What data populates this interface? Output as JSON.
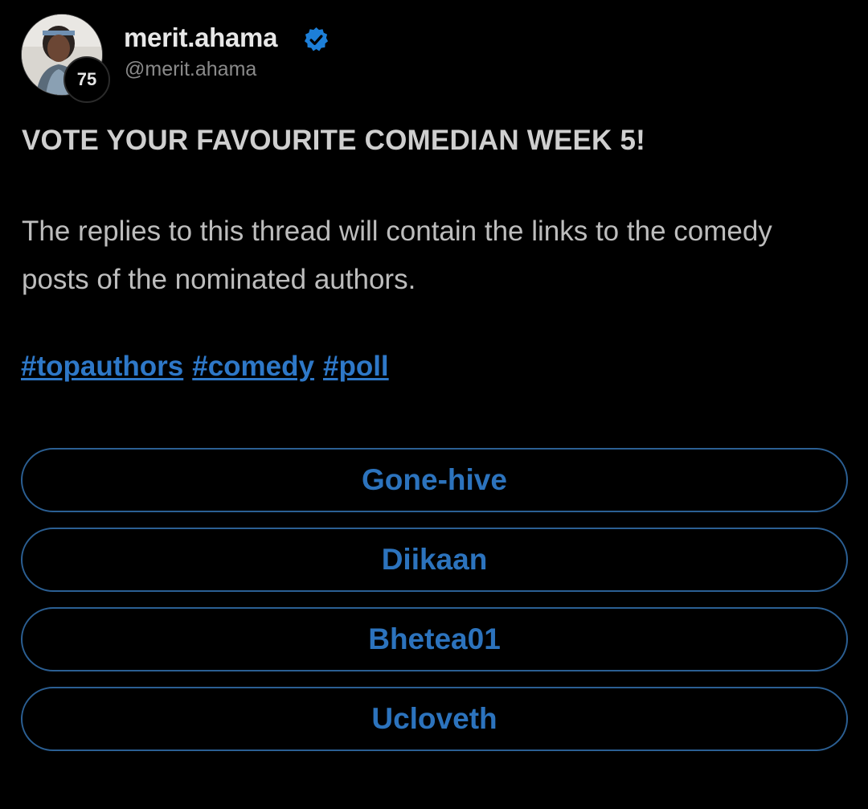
{
  "post": {
    "author": {
      "name": "merit.ahama",
      "handle": "@merit.ahama",
      "reputation": "75",
      "verified": true
    },
    "title": "VOTE YOUR FAVOURITE COMEDIAN WEEK 5!",
    "body": "The replies to this thread will contain the links to the comedy posts of the nominated authors.",
    "tags": [
      "#topauthors",
      "#comedy",
      "#poll"
    ]
  },
  "poll": {
    "options": [
      "Gone-hive",
      "Diikaan",
      "Bhetea01",
      "Ucloveth"
    ]
  },
  "colors": {
    "background": "#000000",
    "accent": "#2c73bd",
    "poll_border": "#2b5f93",
    "verified_badge": "#1d7fd8"
  },
  "icons": {
    "verified": "verified-check-icon",
    "avatar": "user-avatar"
  }
}
